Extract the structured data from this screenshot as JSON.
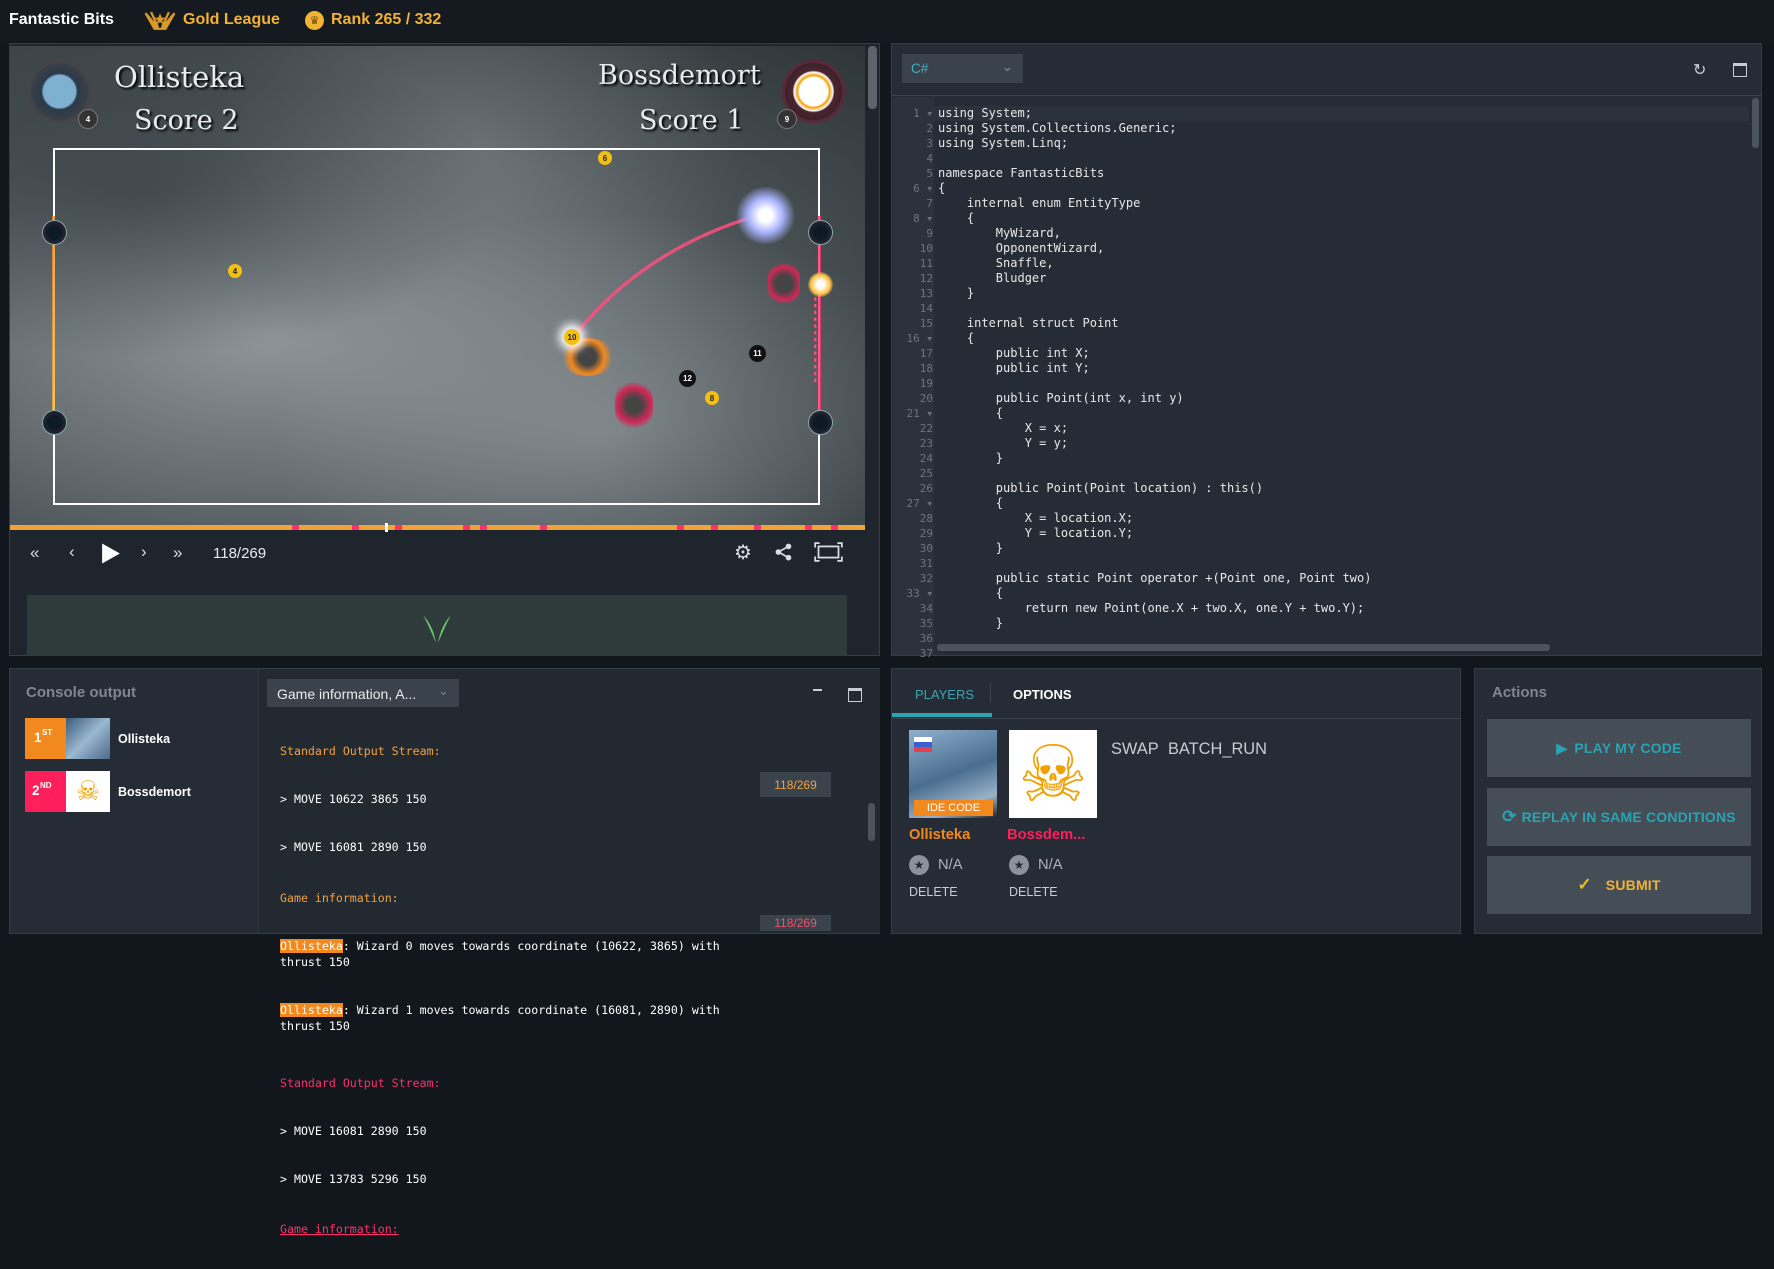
{
  "topbar": {
    "title": "Fantastic Bits",
    "league": "Gold League",
    "rank": "Rank 265 / 332",
    "accent": "#f2b234",
    "league_icon": "laurel-icon",
    "rank_icon": "trophy-icon"
  },
  "game": {
    "player1": {
      "name": "Ollisteka",
      "score": "Score 2",
      "badge": "4"
    },
    "player2": {
      "name": "Bossdemort",
      "score": "Score 1",
      "badge": "9"
    },
    "entities": [
      "6",
      "4",
      "10",
      "11",
      "12",
      "8"
    ],
    "frame": "118/269",
    "progress": 0.4387
  },
  "editor": {
    "language": "C#",
    "lines": [
      "using System;",
      "using System.Collections.Generic;",
      "using System.Linq;",
      "",
      "namespace FantasticBits",
      "{",
      "    internal enum EntityType",
      "    {",
      "        MyWizard,",
      "        OpponentWizard,",
      "        Snaffle,",
      "        Bludger",
      "    }",
      "",
      "    internal struct Point",
      "    {",
      "        public int X;",
      "        public int Y;",
      "",
      "        public Point(int x, int y)",
      "        {",
      "            X = x;",
      "            Y = y;",
      "        }",
      "",
      "        public Point(Point location) : this()",
      "        {",
      "            X = location.X;",
      "            Y = location.Y;",
      "        }",
      "",
      "        public static Point operator +(Point one, Point two)",
      "        {",
      "            return new Point(one.X + two.X, one.Y + two.Y);",
      "        }",
      "",
      ""
    ]
  },
  "console": {
    "title": "Console output",
    "filter": "Game information, A...",
    "ranking": [
      {
        "place": "1",
        "suffix": "ST",
        "name": "Ollisteka",
        "color": "#f2891f"
      },
      {
        "place": "2",
        "suffix": "ND",
        "name": "Bossdemort",
        "color": "#ff1f5a"
      }
    ],
    "block1": {
      "stdout_label": "Standard Output Stream:",
      "out1": "> MOVE 10622 3865 150",
      "out2": "> MOVE 16081 2890 150",
      "info_label": "Game information:",
      "info1_name": "Ollisteka",
      "info1_text": ": Wizard 0 moves towards coordinate (10622, 3865) with thrust 150",
      "info2_name": "Ollisteka",
      "info2_text": ": Wizard 1 moves towards coordinate (16081, 2890) with thrust 150",
      "frame": "118/269"
    },
    "block2": {
      "stdout_label": "Standard Output Stream:",
      "out1": "> MOVE 16081 2890 150",
      "out2": "> MOVE 13783 5296 150",
      "info_label": "Game information:",
      "frame": "118/269"
    }
  },
  "players_panel": {
    "tabs": [
      "PLAYERS",
      "OPTIONS"
    ],
    "swap": "SWAP",
    "batch": "BATCH_RUN",
    "players": [
      {
        "name": "Ollisteka",
        "tag": "IDE CODE",
        "rank": "N/A",
        "delete": "DELETE",
        "color": "#f2891f"
      },
      {
        "name": "Bossdem...",
        "rank": "N/A",
        "delete": "DELETE",
        "color": "#ff1f5a"
      }
    ]
  },
  "actions": {
    "title": "Actions",
    "play": "PLAY MY CODE",
    "replay": "REPLAY IN SAME CONDITIONS",
    "submit": "SUBMIT",
    "teal": "#2aa3b3",
    "gold": "#f2b234"
  }
}
